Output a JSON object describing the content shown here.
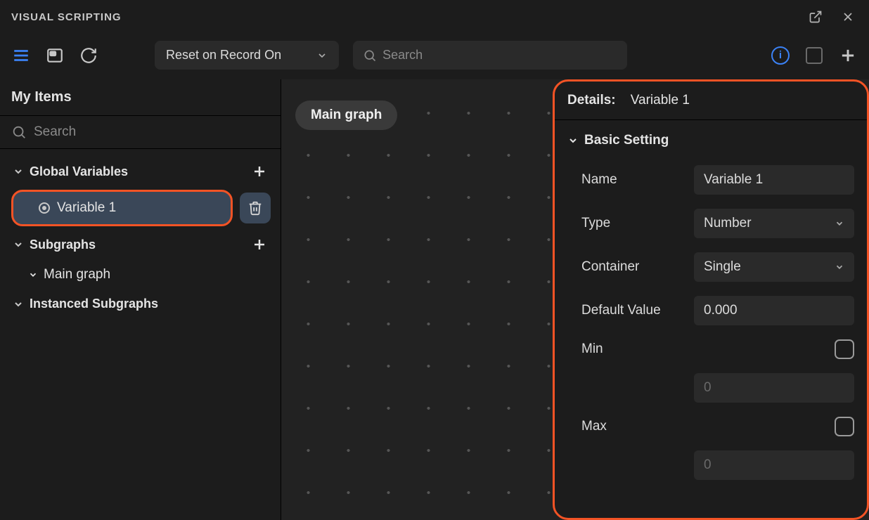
{
  "titlebar": {
    "title": "VISUAL SCRIPTING"
  },
  "toolbar": {
    "reset_label": "Reset on Record On",
    "search_placeholder": "Search"
  },
  "sidebar": {
    "title": "My Items",
    "search_placeholder": "Search",
    "global_variables_label": "Global Variables",
    "variable_item": "Variable 1",
    "subgraphs_label": "Subgraphs",
    "main_graph_label": "Main graph",
    "instanced_subgraphs_label": "Instanced Subgraphs"
  },
  "canvas": {
    "chip_label": "Main graph"
  },
  "details": {
    "header_label": "Details:",
    "header_value": "Variable 1",
    "section_label": "Basic Setting",
    "fields": {
      "name_label": "Name",
      "name_value": "Variable 1",
      "type_label": "Type",
      "type_value": "Number",
      "container_label": "Container",
      "container_value": "Single",
      "default_label": "Default Value",
      "default_value": "0.000",
      "min_label": "Min",
      "min_value": "0",
      "max_label": "Max",
      "max_value": "0"
    }
  }
}
